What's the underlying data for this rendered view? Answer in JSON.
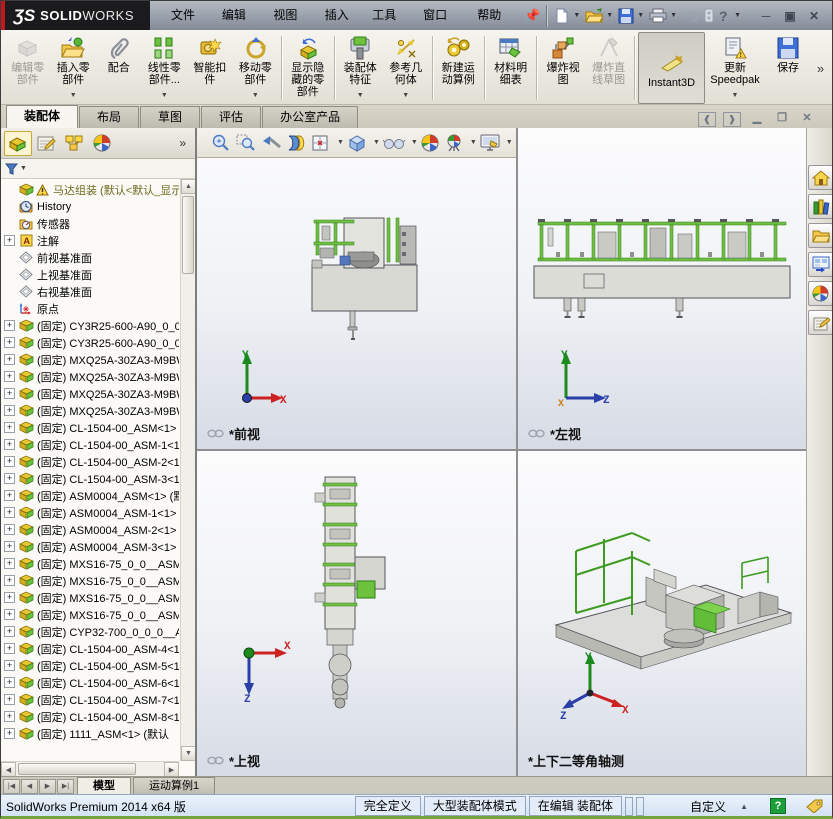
{
  "titlebar": {
    "logo": {
      "mark": "ƷS",
      "name1": "SOLID",
      "name2": "WORKS"
    },
    "menus": [
      "文件(F)",
      "编辑(E)",
      "视图(V)",
      "插入(I)",
      "工具(T)",
      "窗口(W)",
      "帮助(H)"
    ],
    "quick_icons": [
      "new-document",
      "open",
      "save",
      "print",
      "undo",
      "rebuild",
      "help"
    ],
    "window_buttons": {
      "minimize": "─",
      "maximize": "▣",
      "close": "✕"
    }
  },
  "commandbar": {
    "buttons": [
      {
        "label": "编辑零部件",
        "disabled": true
      },
      {
        "label": "插入零部件",
        "dropdown": true
      },
      {
        "label": "配合"
      },
      {
        "label": "线性零部件...",
        "dropdown": true
      },
      {
        "label": "智能扣件"
      },
      {
        "label": "移动零部件",
        "dropdown": true
      },
      {
        "label": "显示隐藏的零部件"
      },
      {
        "label": "装配体特征",
        "dropdown": true
      },
      {
        "label": "参考几何体",
        "dropdown": true
      },
      {
        "label": "新建运动算例"
      },
      {
        "label": "材料明细表"
      },
      {
        "label": "爆炸视图"
      },
      {
        "label": "爆炸直线草图",
        "disabled": true
      },
      {
        "label": "Instant3D",
        "pressed": true
      },
      {
        "label": "更新Speedpak",
        "dropdown": true
      },
      {
        "label": "保存"
      }
    ],
    "overflow": "»"
  },
  "ribbon_tabs": [
    {
      "label": "装配体",
      "active": true
    },
    {
      "label": "布局"
    },
    {
      "label": "草图"
    },
    {
      "label": "评估"
    },
    {
      "label": "办公室产品"
    }
  ],
  "left_panel": {
    "tab_icons": [
      "featuremanager",
      "propertymanager",
      "configurationmanager",
      "displaymanager"
    ],
    "expand_chevron": "»",
    "tree": {
      "root": "马达组装 (默认<默认_显示",
      "special": [
        "History",
        "传感器",
        "注解",
        "前视基准面",
        "上视基准面",
        "右视基准面",
        "原点"
      ],
      "fixed_items": [
        "(固定) CY3R25-600-A90_0_0",
        "(固定) CY3R25-600-A90_0_0",
        "(固定) MXQ25A-30ZA3-M9BW",
        "(固定) MXQ25A-30ZA3-M9BW",
        "(固定) MXQ25A-30ZA3-M9BW",
        "(固定) MXQ25A-30ZA3-M9BW",
        "(固定) CL-1504-00_ASM<1>",
        "(固定) CL-1504-00_ASM-1<1",
        "(固定) CL-1504-00_ASM-2<1",
        "(固定) CL-1504-00_ASM-3<1",
        "(固定) ASM0004_ASM<1> (默",
        "(固定) ASM0004_ASM-1<1>",
        "(固定) ASM0004_ASM-2<1>",
        "(固定) ASM0004_ASM-3<1>",
        "(固定) MXS16-75_0_0__ASM",
        "(固定) MXS16-75_0_0__ASM",
        "(固定) MXS16-75_0_0__ASM",
        "(固定) MXS16-75_0_0__ASM",
        "(固定) CYP32-700_0_0_0__A",
        "(固定) CL-1504-00_ASM-4<1",
        "(固定) CL-1504-00_ASM-5<1",
        "(固定) CL-1504-00_ASM-6<1",
        "(固定) CL-1504-00_ASM-7<1",
        "(固定) CL-1504-00_ASM-8<1",
        "(固定) 1111_ASM<1> (默认"
      ]
    }
  },
  "viewport": {
    "hud_icons": [
      "zoom-fit",
      "zoom-area",
      "previous-view",
      "section-view",
      "view-orientation",
      "display-style",
      "hide-show-items",
      "edit-appearance",
      "apply-scene",
      "view-settings"
    ],
    "views": [
      {
        "label": "*前视",
        "axis_v": "Y",
        "axis_h": "X"
      },
      {
        "label": "*左视",
        "axis_v": "Y",
        "axis_h": "Z",
        "axis_o": "X"
      },
      {
        "label": "*上视",
        "axis_h": "X",
        "axis_d": "Z"
      },
      {
        "label": "*上下二等角轴测",
        "axis_v": "Y",
        "axis_h": "X",
        "axis_l": "Z"
      }
    ]
  },
  "taskpane_icons": [
    "solidworks-resources",
    "design-library",
    "file-explorer",
    "view-palette",
    "appearances",
    "custom-properties"
  ],
  "bottom_tabs": [
    {
      "label": "模型",
      "active": true
    },
    {
      "label": "运动算例1"
    }
  ],
  "statusbar": {
    "left_text": "SolidWorks Premium 2014 x64 版",
    "cells": [
      "完全定义",
      "大型装配体模式",
      "在编辑 装配体"
    ],
    "custom": "自定义"
  },
  "colors": {
    "accent_green": "#72c043",
    "logo_red": "#c01820",
    "titlebar_dark": "#1b1b1d",
    "status_blue": "#d9e6f5"
  }
}
